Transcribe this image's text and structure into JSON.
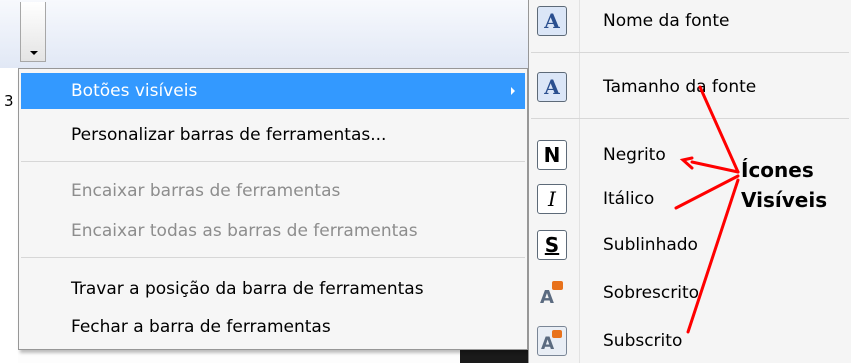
{
  "background": {
    "left_fragment_text": "3"
  },
  "context_menu": {
    "items": [
      {
        "label": "Botões visíveis",
        "state": "highlighted",
        "has_submenu": true
      },
      {
        "label": "Personalizar barras de ferramentas...",
        "state": "enabled"
      },
      {
        "label": "Encaixar barras de ferramentas",
        "state": "disabled"
      },
      {
        "label": "Encaixar todas as barras de ferramentas",
        "state": "disabled"
      },
      {
        "label": "Travar a posição da barra de ferramentas",
        "state": "enabled"
      },
      {
        "label": "Fechar a barra de ferramentas",
        "state": "enabled"
      }
    ]
  },
  "submenu": {
    "items": [
      {
        "label": "Nome da fonte",
        "icon": "font-name-icon",
        "glyph": "A"
      },
      {
        "label": "Tamanho da fonte",
        "icon": "font-size-icon",
        "glyph": "A"
      },
      {
        "label": "Negrito",
        "icon": "bold-icon",
        "glyph": "N"
      },
      {
        "label": "Itálico",
        "icon": "italic-icon",
        "glyph": "I"
      },
      {
        "label": "Sublinhado",
        "icon": "underline-icon",
        "glyph": "S"
      },
      {
        "label": "Sobrescrito",
        "icon": "superscript-icon",
        "glyph": "A"
      },
      {
        "label": "Subscrito",
        "icon": "subscript-icon",
        "glyph": "A"
      }
    ]
  },
  "annotation": {
    "line1": "Ícones",
    "line2": "Visíveis",
    "color": "#ff0000"
  },
  "colors": {
    "highlight": "#3399ff",
    "disabled_text": "#8d8d8d",
    "menu_background": "#f6f6f6"
  }
}
